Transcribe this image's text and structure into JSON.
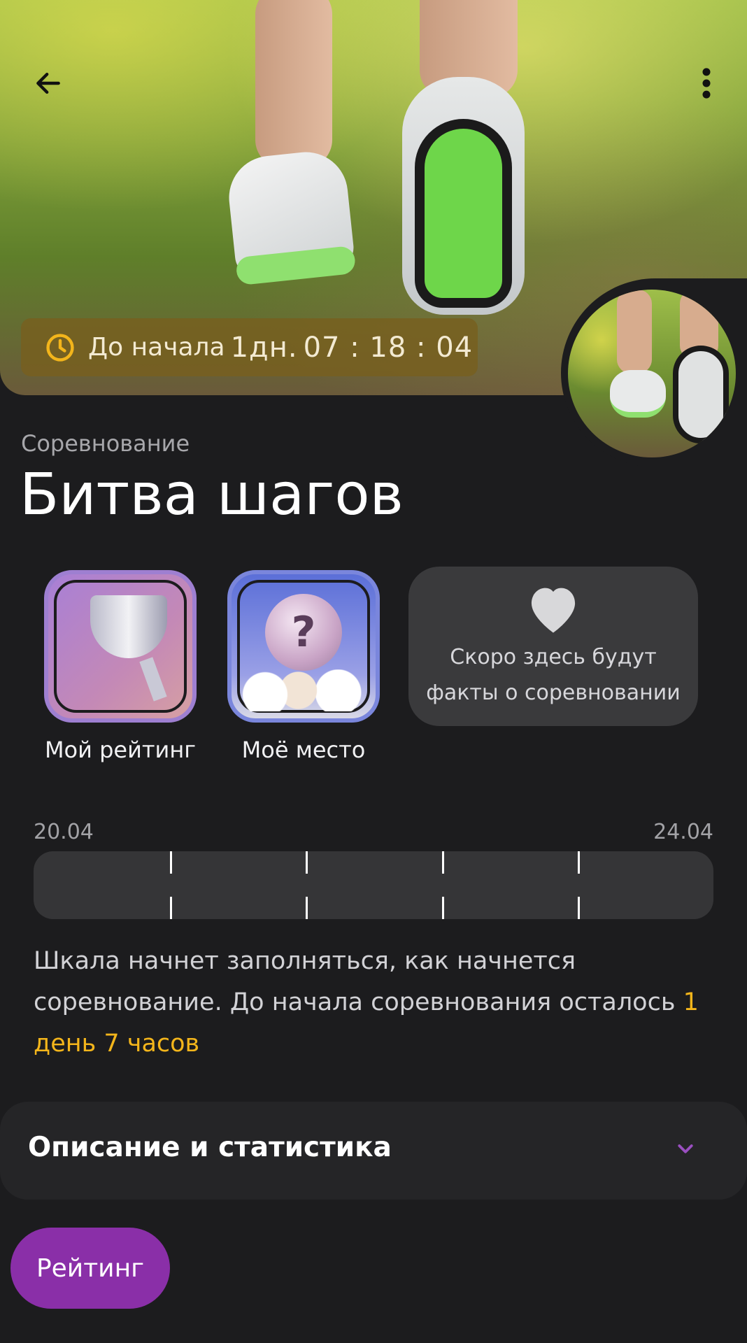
{
  "header": {
    "timer_prefix": "До начала",
    "timer_days": "1дн.",
    "timer_time": "07 : 18 : 04"
  },
  "competition": {
    "subtitle": "Соревнование",
    "title": "Битва шагов"
  },
  "badges": [
    {
      "label": "Мой рейтинг",
      "icon": "trophy-cup-icon"
    },
    {
      "label": "Моё место",
      "icon": "mystery-medal-icon"
    }
  ],
  "facts": {
    "line1": "Скоро здесь будут",
    "line2": "факты о соревновании",
    "icon": "heart-icon"
  },
  "progress": {
    "start_date": "20.04",
    "end_date": "24.04",
    "filled": 0,
    "note_main": "Шкала начнет заполняться, как начнется соревнование. До начала соревнования осталось ",
    "note_accent": "1 день 7 часов"
  },
  "description": {
    "title": "Описание и статистика"
  },
  "fab": {
    "label": "Рейтинг"
  },
  "colors": {
    "accent_purple": "#8a2fa8",
    "accent_yellow": "#f3b51b",
    "timer_bg": "#785f1e"
  }
}
